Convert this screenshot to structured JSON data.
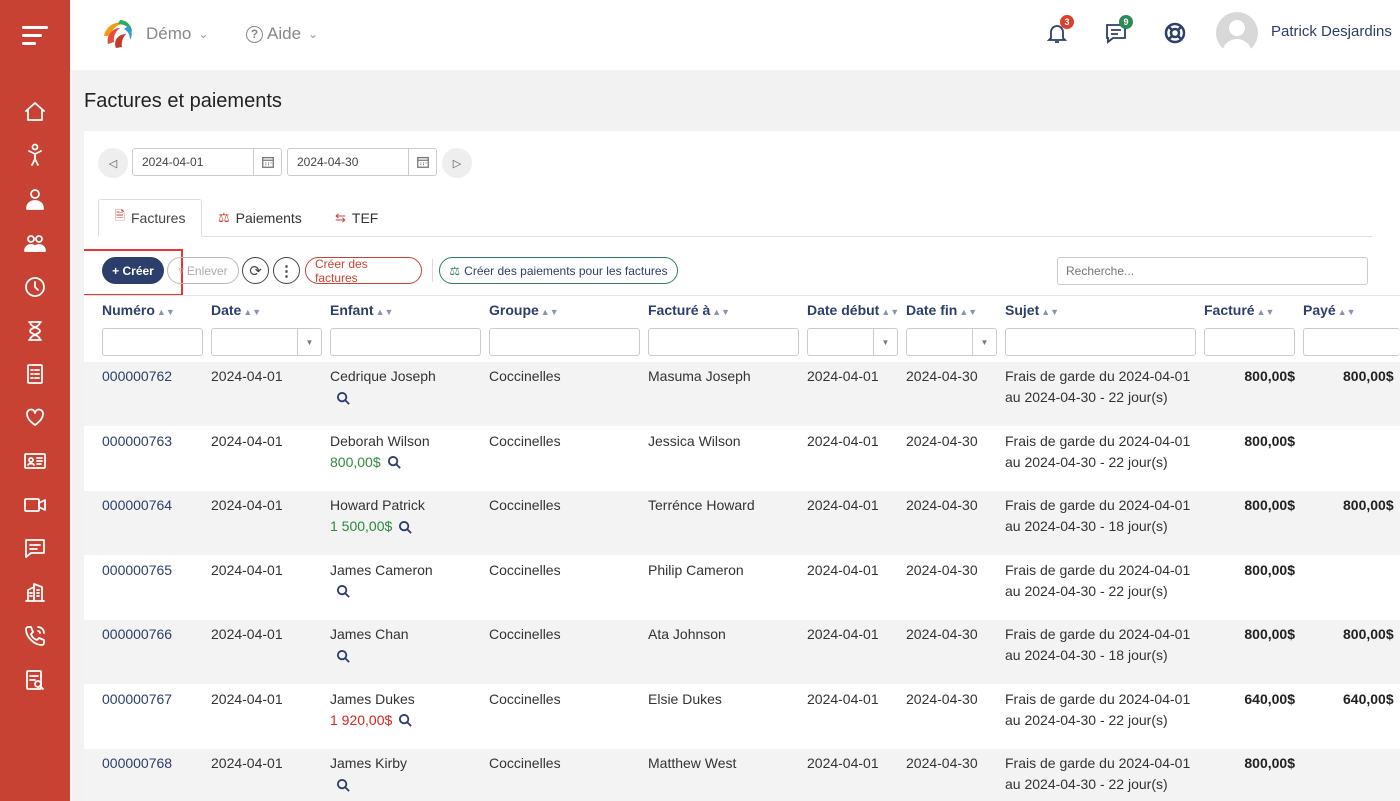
{
  "header": {
    "company_menu": "Démo",
    "help_menu": "Aide",
    "help_symbol": "?",
    "notifications_count": "3",
    "messages_count": "9",
    "username": "Patrick Desjardins",
    "badge_notif_color": "#d9412e",
    "badge_msg_color": "#2e8b57"
  },
  "page": {
    "title": "Factures et paiements"
  },
  "date_range": {
    "start": "2024-04-01",
    "end": "2024-04-30"
  },
  "tabs": [
    {
      "label": "Factures",
      "icon": "invoice-icon"
    },
    {
      "label": "Paiements",
      "icon": "payment-icon"
    },
    {
      "label": "TEF",
      "icon": "transfer-icon"
    }
  ],
  "toolbar": {
    "create_label": "+ Créer",
    "remove_label": "Enlever",
    "create_invoices_label": "Créer des factures",
    "create_payments_label": "Créer des paiements pour les factures",
    "search_placeholder": "Recherche..."
  },
  "table": {
    "columns": [
      "Numéro",
      "Date",
      "Enfant",
      "Groupe",
      "Facturé à",
      "Date début",
      "Date fin",
      "Sujet",
      "Facturé",
      "Payé"
    ],
    "rows": [
      {
        "numero": "000000762",
        "date": "2024-04-01",
        "enfant": "Cedrique Joseph",
        "credit": "",
        "groupe": "Coccinelles",
        "facture_a": "Masuma Joseph",
        "debut": "2024-04-01",
        "fin": "2024-04-30",
        "sujet1": "Frais de garde du 2024-04-01",
        "sujet2": "au 2024-04-30 - 22 jour(s)",
        "facture": "800,00$",
        "paye": "800,00$"
      },
      {
        "numero": "000000763",
        "date": "2024-04-01",
        "enfant": "Deborah Wilson",
        "credit": "800,00$",
        "groupe": "Coccinelles",
        "facture_a": "Jessica Wilson",
        "debut": "2024-04-01",
        "fin": "2024-04-30",
        "sujet1": "Frais de garde du 2024-04-01",
        "sujet2": "au 2024-04-30 - 22 jour(s)",
        "facture": "800,00$",
        "paye": ""
      },
      {
        "numero": "000000764",
        "date": "2024-04-01",
        "enfant": "Howard Patrick",
        "credit": "1 500,00$",
        "groupe": "Coccinelles",
        "facture_a": "Terrénce Howard",
        "debut": "2024-04-01",
        "fin": "2024-04-30",
        "sujet1": "Frais de garde du 2024-04-01",
        "sujet2": "au 2024-04-30 - 18 jour(s)",
        "facture": "800,00$",
        "paye": "800,00$"
      },
      {
        "numero": "000000765",
        "date": "2024-04-01",
        "enfant": "James Cameron",
        "credit": "",
        "groupe": "Coccinelles",
        "facture_a": "Philip Cameron",
        "debut": "2024-04-01",
        "fin": "2024-04-30",
        "sujet1": "Frais de garde du 2024-04-01",
        "sujet2": "au 2024-04-30 - 22 jour(s)",
        "facture": "800,00$",
        "paye": ""
      },
      {
        "numero": "000000766",
        "date": "2024-04-01",
        "enfant": "James Chan",
        "credit": "",
        "groupe": "Coccinelles",
        "facture_a": "Ata Johnson",
        "debut": "2024-04-01",
        "fin": "2024-04-30",
        "sujet1": "Frais de garde du 2024-04-01",
        "sujet2": "au 2024-04-30 - 18 jour(s)",
        "facture": "800,00$",
        "paye": "800,00$"
      },
      {
        "numero": "000000767",
        "date": "2024-04-01",
        "enfant": "James Dukes",
        "credit": "1 920,00$",
        "credit_negative": true,
        "groupe": "Coccinelles",
        "facture_a": "Elsie Dukes",
        "debut": "2024-04-01",
        "fin": "2024-04-30",
        "sujet1": "Frais de garde du 2024-04-01",
        "sujet2": "au 2024-04-30 - 22 jour(s)",
        "facture": "640,00$",
        "paye": "640,00$"
      },
      {
        "numero": "000000768",
        "date": "2024-04-01",
        "enfant": "James Kirby",
        "credit": "",
        "groupe": "Coccinelles",
        "facture_a": "Matthew West",
        "debut": "2024-04-01",
        "fin": "2024-04-30",
        "sujet1": "Frais de garde du 2024-04-01",
        "sujet2": "au 2024-04-30 - 22 jour(s)",
        "facture": "800,00$",
        "paye": ""
      }
    ]
  },
  "sidebar": {
    "items": [
      "home-icon",
      "child-icon",
      "staff-icon",
      "parents-icon",
      "clock-icon",
      "hourglass-icon",
      "invoice-list-icon",
      "heart-icon",
      "id-card-icon",
      "video-icon",
      "chat-icon",
      "building-icon",
      "phone-icon",
      "report-icon"
    ]
  }
}
